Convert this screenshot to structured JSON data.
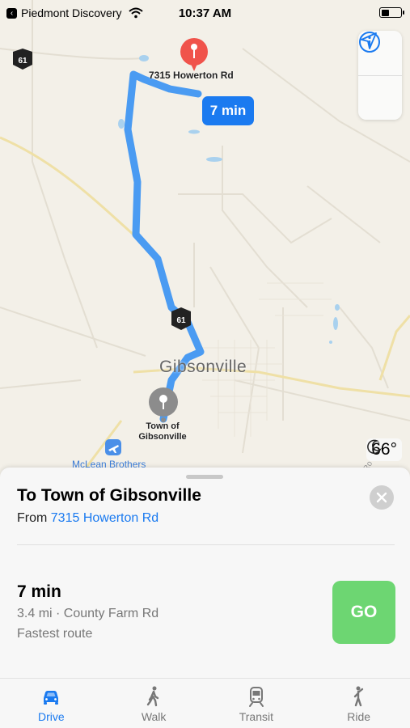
{
  "status_bar": {
    "back_app": "Piedmont Discovery",
    "time": "10:37 AM",
    "back_icon": "chevron-left-icon"
  },
  "map": {
    "destination_label": "7315 Howerton Rd",
    "origin_label": "Town of Gibsonville",
    "city_label": "Gibsonville",
    "airport_label": "McLean Brothers",
    "route_time_bubble": "7 min",
    "highway_shield": "61",
    "route_color": "#4a9bf2",
    "pin_color": "#f0534b",
    "info_icon": "info-icon",
    "location_icon": "location-arrow-icon"
  },
  "weather": {
    "icon": "moon-icon",
    "temperature": "66°"
  },
  "sheet": {
    "title": "To Town of Gibsonville",
    "from_prefix": "From",
    "from_place": "7315 Howerton Rd",
    "route_time": "7 min",
    "route_details": "3.4 mi · County Farm Rd",
    "route_note": "Fastest route",
    "go_label": "GO",
    "go_color": "#6dd672",
    "accent_color": "#1a7af0"
  },
  "tabs": [
    {
      "label": "Drive",
      "icon": "car-icon",
      "active": true
    },
    {
      "label": "Walk",
      "icon": "walk-icon",
      "active": false
    },
    {
      "label": "Transit",
      "icon": "train-icon",
      "active": false
    },
    {
      "label": "Ride",
      "icon": "ride-icon",
      "active": false
    }
  ]
}
